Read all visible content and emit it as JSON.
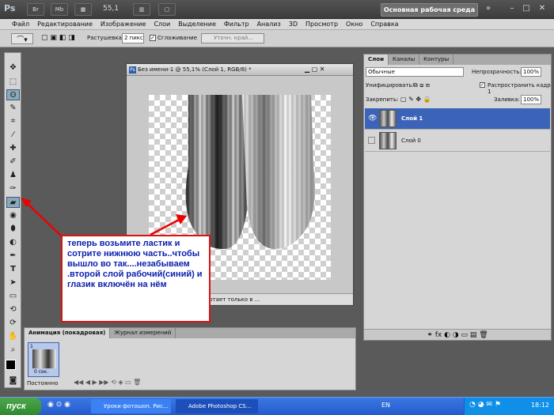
{
  "appbar": {
    "logo": "Ps",
    "zoom": "55,1",
    "workspace": "Основная рабочая среда"
  },
  "menu": [
    "Файл",
    "Редактирование",
    "Изображение",
    "Слои",
    "Выделение",
    "Фильтр",
    "Анализ",
    "3D",
    "Просмотр",
    "Окно",
    "Справка"
  ],
  "options": {
    "feather_label": "Растушевка:",
    "feather_value": "2 пикс",
    "antialias_label": "Сглаживание",
    "refine_button": "Уточн. край..."
  },
  "document": {
    "title": "Без имени-1 @ 55,1% (Слой 1, RGB/8) *",
    "status": "ботает только в ..."
  },
  "note": {
    "text": "теперь возьмите ластик и сотрите нижнюю часть..чтобы вышло во так....незабываем .второй слой рабочий(синий) и глазик включён на нём"
  },
  "layers_panel": {
    "tabs": [
      "Слои",
      "Каналы",
      "Контуры"
    ],
    "blend_mode": "Обычные",
    "opacity_label": "Непрозрачность:",
    "opacity_value": "100%",
    "unify_label": "Унифицировать:",
    "propagate_label": "Распространить кадр 1",
    "lock_label": "Закрепить:",
    "fill_label": "Заливка:",
    "fill_value": "100%",
    "layers": [
      {
        "name": "Слой 1",
        "selected": true
      },
      {
        "name": "Слой 0",
        "selected": false
      }
    ]
  },
  "animation_panel": {
    "tabs": [
      "Анимация (покадровая)",
      "Журнал измерений"
    ],
    "frame_number": "1",
    "frame_delay": "0 сек.",
    "loop": "Постоянно"
  },
  "taskbar": {
    "start": "пуск",
    "tasks": [
      "Уроки фотошоп. Рис...",
      "Adobe Photoshop CS..."
    ],
    "lang": "EN",
    "time": "18:12"
  }
}
